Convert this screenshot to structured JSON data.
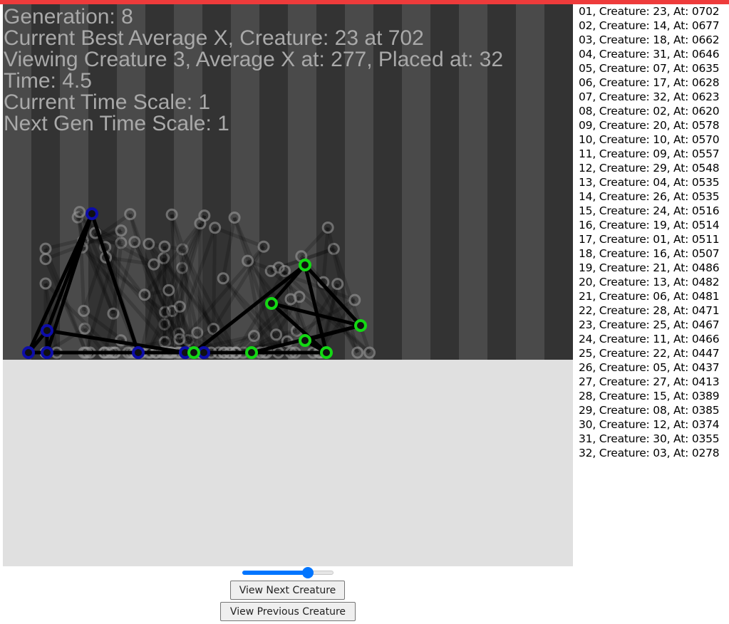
{
  "colors": {
    "accent_bar": "#ee3b3b",
    "sky_stripe_light": "#4a4a4a",
    "sky_stripe_dark": "#333333",
    "ground": "#e0e0e0",
    "hud_text": "#a9a9a9",
    "viewed_creature_nodes": "#0d0da8",
    "viewed_creature_nodes_alt": "#14d814",
    "ghost_creatures": "#9a9a9a",
    "slider_accent": "#0075ff"
  },
  "hud": {
    "generation": "Generation: 8",
    "best": "Current Best Average X, Creature: 23 at 702",
    "viewing": "Viewing Creature 3, Average X at: 277, Placed at: 32",
    "time": "Time: 4.5",
    "current_time_scale": "Current Time Scale: 1",
    "next_time_scale": "Next Gen Time Scale: 1"
  },
  "leaderboard": [
    "01, Creature: 23, At: 0702",
    "02, Creature: 14, At: 0677",
    "03, Creature: 18, At: 0662",
    "04, Creature: 31, At: 0646",
    "05, Creature: 07, At: 0635",
    "06, Creature: 17, At: 0628",
    "07, Creature: 32, At: 0623",
    "08, Creature: 02, At: 0620",
    "09, Creature: 20, At: 0578",
    "10, Creature: 10, At: 0570",
    "11, Creature: 09, At: 0557",
    "12, Creature: 29, At: 0548",
    "13, Creature: 04, At: 0535",
    "14, Creature: 26, At: 0535",
    "15, Creature: 24, At: 0516",
    "16, Creature: 19, At: 0514",
    "17, Creature: 01, At: 0511",
    "18, Creature: 16, At: 0507",
    "19, Creature: 21, At: 0486",
    "20, Creature: 13, At: 0482",
    "21, Creature: 06, At: 0481",
    "22, Creature: 28, At: 0471",
    "23, Creature: 25, At: 0467",
    "24, Creature: 11, At: 0466",
    "25, Creature: 22, At: 0447",
    "26, Creature: 05, At: 0437",
    "27, Creature: 27, At: 0413",
    "28, Creature: 15, At: 0389",
    "29, Creature: 08, At: 0385",
    "30, Creature: 12, At: 0374",
    "31, Creature: 30, At: 0355",
    "32, Creature: 03, At: 0278"
  ],
  "controls": {
    "slider_value_fraction": 0.72,
    "next_label": "View Next Creature",
    "prev_label": "View Previous Creature"
  }
}
